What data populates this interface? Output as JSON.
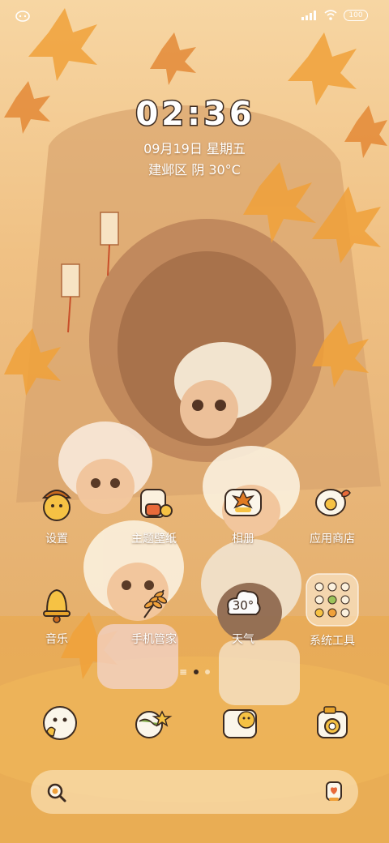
{
  "status": {
    "battery": "100"
  },
  "clock": {
    "digits": [
      "0",
      "2",
      ":",
      "3",
      "6"
    ]
  },
  "date": "09月19日 星期五",
  "weather": "建邺区 阴 30°C",
  "apps": [
    {
      "label": "设置",
      "icon": "acorn-settings-icon"
    },
    {
      "label": "主题壁纸",
      "icon": "bear-theme-icon"
    },
    {
      "label": "相册",
      "icon": "maple-photo-icon"
    },
    {
      "label": "应用商店",
      "icon": "bird-store-icon"
    },
    {
      "label": "音乐",
      "icon": "bell-music-icon"
    },
    {
      "label": "手机管家",
      "icon": "wheat-manager-icon"
    },
    {
      "label": "天气",
      "icon": "cloud-weather-icon",
      "badge": "30°"
    },
    {
      "label": "系统工具",
      "icon": "folder-icon"
    }
  ],
  "dock": [
    {
      "icon": "chick-phone-icon"
    },
    {
      "icon": "globe-browser-icon"
    },
    {
      "icon": "chick-messages-icon"
    },
    {
      "icon": "camera-icon"
    }
  ],
  "colors": {
    "accent": "#f0a13a",
    "outline": "#3b2a20",
    "leaf": "#e07a22"
  }
}
